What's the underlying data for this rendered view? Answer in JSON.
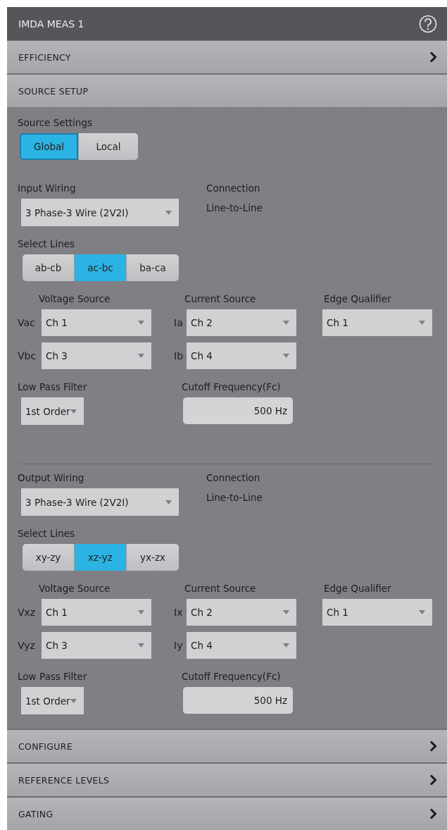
{
  "title": "IMDA MEAS 1",
  "sections_top": [
    {
      "label": "EFFICIENCY",
      "expanded": false
    },
    {
      "label": "SOURCE SETUP",
      "expanded": true
    }
  ],
  "source_settings": {
    "label": "Source Settings",
    "options": [
      {
        "label": "Global",
        "selected": true
      },
      {
        "label": "Local",
        "selected": false
      }
    ]
  },
  "groups": [
    {
      "wiring_label": "Input Wiring",
      "wiring_value": "3 Phase-3 Wire (2V2I)",
      "connection_label": "Connection",
      "connection_value": "Line-to-Line",
      "lines_label": "Select Lines",
      "lines": [
        {
          "label": "ab-cb",
          "selected": false
        },
        {
          "label": "ac-bc",
          "selected": true
        },
        {
          "label": "ba-ca",
          "selected": false
        }
      ],
      "voltage_label": "Voltage Source",
      "voltage": [
        {
          "name": "Vac",
          "value": "Ch 1"
        },
        {
          "name": "Vbc",
          "value": "Ch 3"
        }
      ],
      "current_label": "Current Source",
      "current": [
        {
          "name": "Ia",
          "value": "Ch 2"
        },
        {
          "name": "Ib",
          "value": "Ch 4"
        }
      ],
      "edge_label": "Edge Qualifier",
      "edge_value": "Ch 1",
      "filter_label": "Low Pass Filter",
      "filter_value": "1st Order",
      "cutoff_label": "Cutoff Frequency(Fc)",
      "cutoff_value": "500 Hz"
    },
    {
      "wiring_label": "Output Wiring",
      "wiring_value": "3 Phase-3 Wire (2V2I)",
      "connection_label": "Connection",
      "connection_value": "Line-to-Line",
      "lines_label": "Select Lines",
      "lines": [
        {
          "label": "xy-zy",
          "selected": false
        },
        {
          "label": "xz-yz",
          "selected": true
        },
        {
          "label": "yx-zx",
          "selected": false
        }
      ],
      "voltage_label": "Voltage Source",
      "voltage": [
        {
          "name": "Vxz",
          "value": "Ch 1"
        },
        {
          "name": "Vyz",
          "value": "Ch 3"
        }
      ],
      "current_label": "Current Source",
      "current": [
        {
          "name": "Ix",
          "value": "Ch 2"
        },
        {
          "name": "Iy",
          "value": "Ch 4"
        }
      ],
      "edge_label": "Edge Qualifier",
      "edge_value": "Ch 1",
      "filter_label": "Low Pass Filter",
      "filter_value": "1st Order",
      "cutoff_label": "Cutoff Frequency(Fc)",
      "cutoff_value": "500 Hz"
    }
  ],
  "sections_bottom": [
    {
      "label": "CONFIGURE",
      "expanded": false
    },
    {
      "label": "REFERENCE LEVELS",
      "expanded": false
    },
    {
      "label": "GATING",
      "expanded": false
    }
  ]
}
